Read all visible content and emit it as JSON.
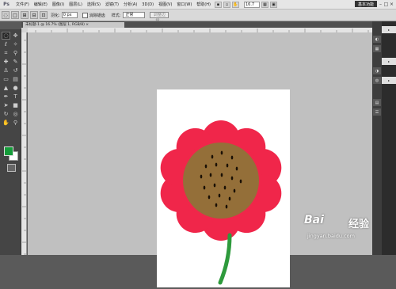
{
  "app": {
    "logo": "Ps"
  },
  "menubar": {
    "items": [
      "文件(F)",
      "编辑(E)",
      "图像(I)",
      "图层(L)",
      "选择(S)",
      "滤镜(T)",
      "分析(A)",
      "3D(D)",
      "视图(V)",
      "窗口(W)",
      "帮助(H)"
    ],
    "zoom": "16.7",
    "workspace": "基本功能",
    "window_controls": [
      "–",
      "□",
      "×"
    ]
  },
  "options_bar": {
    "feather_label": "羽化:",
    "feather_value": "0 px",
    "antialias_label": "消除锯齿",
    "style_label": "样式:",
    "style_value": "正常",
    "refine_edge_label": "调整边缘..."
  },
  "document": {
    "tab_title": "未标题-1 @ 16.7% (图层 1, RGB/8) ×"
  },
  "colors": {
    "foreground": "#159c3a",
    "background": "#ffffff",
    "petal": "#f0264a",
    "center": "#946f39",
    "seed": "#1a1005",
    "stem": "#2e9a3c"
  },
  "watermark": {
    "logo": "Bai",
    "suffix": "经验",
    "site": "jingyan.baidu.com"
  }
}
